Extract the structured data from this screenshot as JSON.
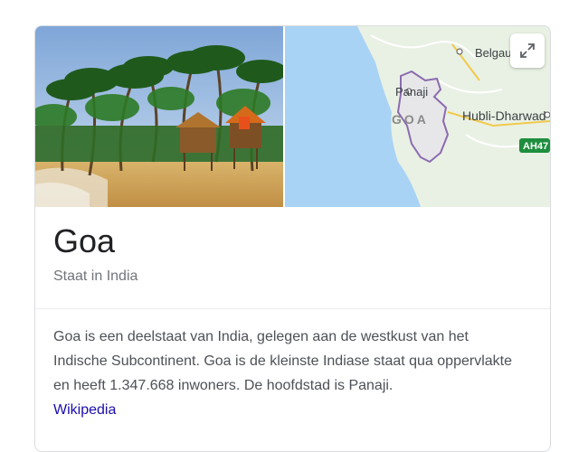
{
  "entity": {
    "title": "Goa",
    "subtitle": "Staat in India"
  },
  "map": {
    "labels": {
      "belgaum": "Belgaum",
      "panaji": "Panaji",
      "region": "GOA",
      "hubli": "Hubli-Dharwad",
      "highway": "AH47"
    },
    "colors": {
      "sea": "#a9d3f5",
      "land": "#e9f1e4",
      "border": "#8b6bb0",
      "highway": "#1e8e3e"
    }
  },
  "description": {
    "text": "Goa is een deelstaat van India, gelegen aan de westkust van het Indische Subcontinent. Goa is de kleinste Indiase staat qua oppervlakte en heeft 1.347.668 inwoners. De hoofdstad is Panaji.",
    "source_link": "Wikipedia"
  }
}
